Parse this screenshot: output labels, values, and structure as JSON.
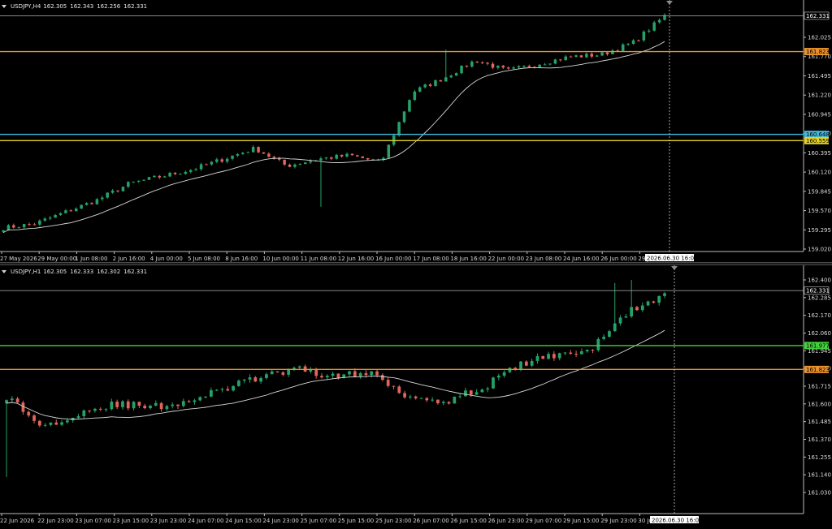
{
  "colors": {
    "bull": "#26a269",
    "bear": "#e0655a",
    "ma": "#d8d8d8",
    "axis_text": "#d8d8d8",
    "orange": "#e8912d",
    "cyan": "#3fb8e0",
    "yellow": "#e4d020",
    "green": "#44d13c",
    "bid": "#9a9a9a"
  },
  "panes": [
    {
      "symbol": "USDJPY,H4",
      "ohlc": [
        "162.305",
        "162.343",
        "162.256",
        "162.331"
      ],
      "price_labels": [
        "162.025",
        "161.770",
        "161.495",
        "161.220",
        "160.945",
        "160.670",
        "160.395",
        "160.120",
        "159.845",
        "159.570",
        "159.295",
        "159.020"
      ],
      "time_labels": [
        "27 May 2026",
        "29 May 00:00",
        "1 Jun 08:00",
        "2 Jun 16:00",
        "4 Jun 00:00",
        "5 Jun 08:00",
        "8 Jun 16:00",
        "10 Jun 00:00",
        "11 Jun 08:00",
        "12 Jun 16:00",
        "16 Jun 00:00",
        "17 Jun 08:00",
        "18 Jun 16:00",
        "22 Jun 00:00",
        "23 Jun 08:00",
        "24 Jun 16:00",
        "26 Jun 00:00",
        "29 Jun"
      ],
      "crosshair_label": "2026.06.30 16:00",
      "bid": {
        "label": "162.331",
        "value": 162.331
      },
      "levels": [
        {
          "label": "161.823",
          "value": 161.823,
          "color": "#e8912d"
        },
        {
          "label": "160.648",
          "value": 160.648,
          "color": "#3fb8e0"
        },
        {
          "label": "160.559",
          "value": 160.559,
          "color": "#e4d020"
        }
      ]
    },
    {
      "symbol": "USDJPY,H1",
      "ohlc": [
        "162.305",
        "162.333",
        "162.302",
        "162.331"
      ],
      "price_labels": [
        "162.400",
        "162.285",
        "162.170",
        "162.060",
        "161.945",
        "161.830",
        "161.715",
        "161.600",
        "161.485",
        "161.370",
        "161.255",
        "161.140",
        "161.030"
      ],
      "time_labels": [
        "22 Jun 2026",
        "22 Jun 23:00",
        "23 Jun 07:00",
        "23 Jun 15:00",
        "23 Jun 23:00",
        "24 Jun 07:00",
        "24 Jun 15:00",
        "24 Jun 23:00",
        "25 Jun 07:00",
        "25 Jun 15:00",
        "25 Jun 23:00",
        "26 Jun 07:00",
        "26 Jun 15:00",
        "26 Jun 23:00",
        "29 Jun 07:00",
        "29 Jun 15:00",
        "29 Jun 23:00",
        "30 Jun"
      ],
      "crosshair_label": "2026.06.30 16:00",
      "bid": {
        "label": "162.331",
        "value": 162.331
      },
      "levels": [
        {
          "label": "161.977",
          "value": 161.977,
          "color": "#44d13c"
        },
        {
          "label": "161.823",
          "value": 161.823,
          "color": "#e8912d"
        }
      ]
    }
  ]
}
